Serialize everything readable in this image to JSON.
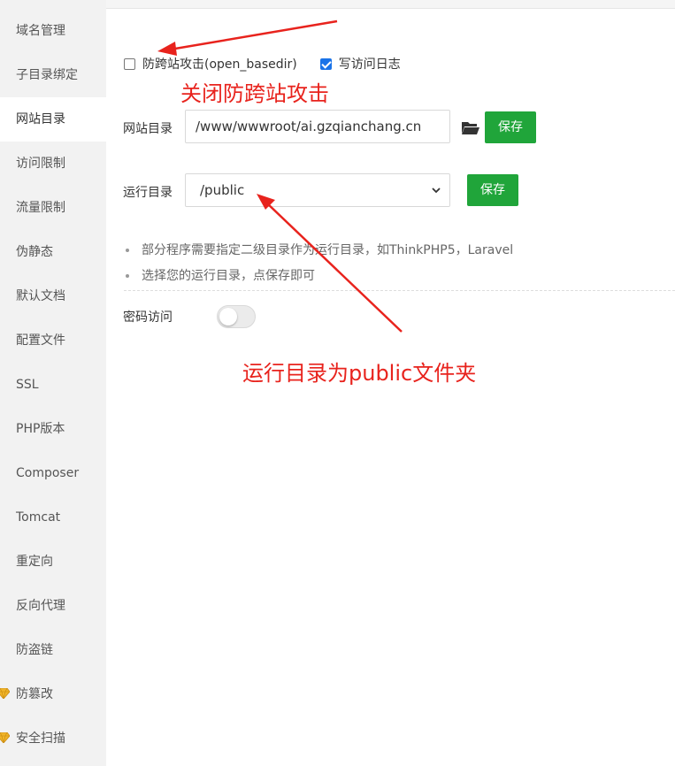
{
  "sidebar": {
    "items": [
      {
        "label": "域名管理"
      },
      {
        "label": "子目录绑定"
      },
      {
        "label": "网站目录"
      },
      {
        "label": "访问限制"
      },
      {
        "label": "流量限制"
      },
      {
        "label": "伪静态"
      },
      {
        "label": "默认文档"
      },
      {
        "label": "配置文件"
      },
      {
        "label": "SSL"
      },
      {
        "label": "PHP版本"
      },
      {
        "label": "Composer"
      },
      {
        "label": "Tomcat"
      },
      {
        "label": "重定向"
      },
      {
        "label": "反向代理"
      },
      {
        "label": "防盗链"
      },
      {
        "label": "防篡改"
      },
      {
        "label": "安全扫描"
      }
    ],
    "active_item": "网站目录"
  },
  "options": {
    "anti_xss_label": "防跨站攻击(open_basedir)",
    "anti_xss_checked": false,
    "access_log_label": "写访问日志",
    "access_log_checked": true
  },
  "site_dir": {
    "label": "网站目录",
    "value": "/www/wwwroot/ai.gzqianchang.cn",
    "save_label": "保存"
  },
  "run_dir": {
    "label": "运行目录",
    "value": "/public",
    "save_label": "保存"
  },
  "notes": [
    "部分程序需要指定二级目录作为运行目录，如ThinkPHP5，Laravel",
    "选择您的运行目录，点保存即可"
  ],
  "password_access": {
    "label": "密码访问",
    "enabled": false
  },
  "annotations": {
    "close_anti_xss": "关闭防跨站攻击",
    "run_dir_public": "运行目录为public文件夹"
  },
  "colors": {
    "accent": "#20a53a",
    "annotation": "#e8231d",
    "checkbox": "#1a73e8"
  }
}
